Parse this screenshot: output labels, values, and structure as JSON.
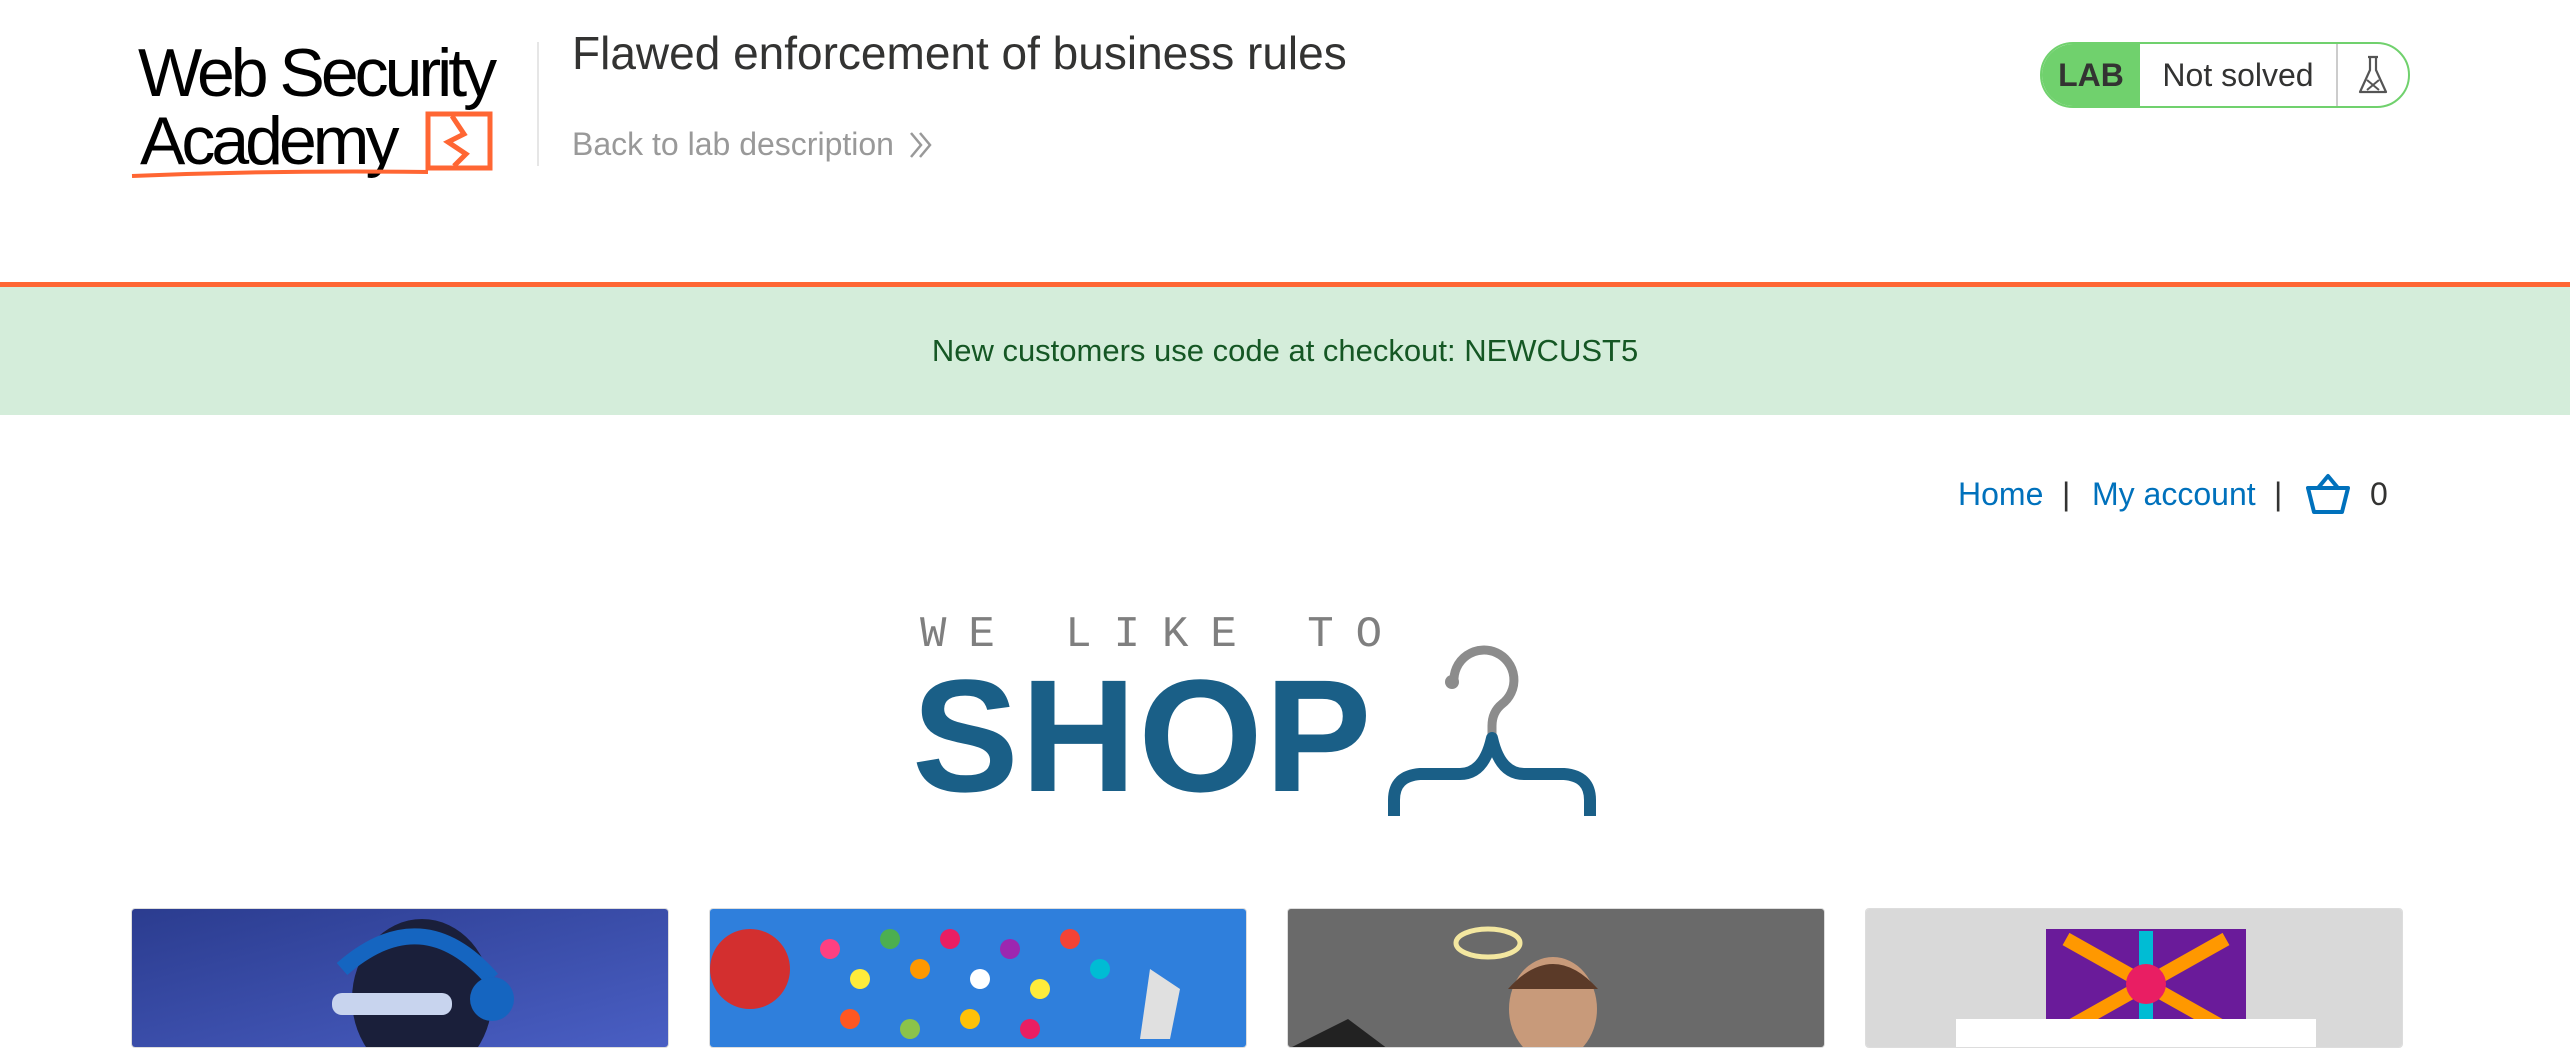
{
  "header": {
    "logo_text_line1": "Web Security",
    "logo_text_line2": "Academy",
    "lab_title": "Flawed enforcement of business rules",
    "back_link": "Back to lab description"
  },
  "status": {
    "badge": "LAB",
    "state": "Not solved",
    "icon": "flask-icon"
  },
  "notice": {
    "text": "New customers use code at checkout: NEWCUST5"
  },
  "nav": {
    "home": "Home",
    "separator": "|",
    "account": "My account",
    "cart_icon": "cart-icon",
    "cart_count": "0"
  },
  "banner": {
    "tagline": "WE LIKE TO",
    "title": "SHOP",
    "icon": "hanger-icon"
  },
  "products": [
    {
      "image": "person-with-headphones-image"
    },
    {
      "image": "balloons-image"
    },
    {
      "image": "man-with-halo-image"
    },
    {
      "image": "colorful-sign-image"
    }
  ],
  "colors": {
    "accent_orange": "#ff6633",
    "lab_green": "#70d16d",
    "link_blue": "#0071bc",
    "notice_bg": "#d4edda",
    "notice_text": "#155724",
    "shop_blue": "#1a5f87"
  }
}
